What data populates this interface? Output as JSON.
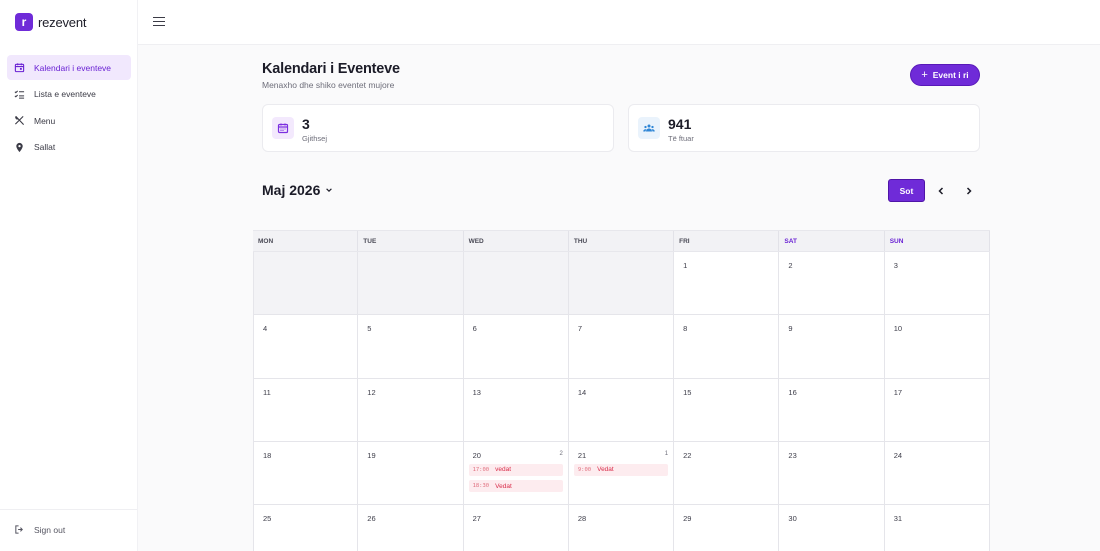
{
  "app": {
    "logo_letter": "r",
    "name": "rezevent",
    "accent": "#6f2bd8"
  },
  "sidebar": {
    "items": [
      {
        "label": "Kalendari i eventeve",
        "icon": "calendar-icon",
        "active": true
      },
      {
        "label": "Lista e eventeve",
        "icon": "checklist-icon",
        "active": false
      },
      {
        "label": "Menu",
        "icon": "utensils-icon",
        "active": false
      },
      {
        "label": "Sallat",
        "icon": "map-pin-icon",
        "active": false
      }
    ],
    "signout": "Sign out"
  },
  "header": {
    "title": "Kalendari i Eventeve",
    "subtitle": "Menaxho dhe shiko eventet mujore",
    "new_event_label": "Event i ri"
  },
  "stats": [
    {
      "value": "3",
      "label": "Gjithsej",
      "icon": "calendar-icon"
    },
    {
      "value": "941",
      "label": "Të ftuar",
      "icon": "users-icon"
    }
  ],
  "calendar": {
    "month_label": "Maj 2026",
    "today_label": "Sot",
    "weekdays": [
      "MON",
      "TUE",
      "WED",
      "THU",
      "FRI",
      "SAT",
      "SUN"
    ],
    "weeks": [
      [
        null,
        null,
        null,
        null,
        {
          "day": "1"
        },
        {
          "day": "2"
        },
        {
          "day": "3"
        }
      ],
      [
        {
          "day": "4"
        },
        {
          "day": "5"
        },
        {
          "day": "6"
        },
        {
          "day": "7"
        },
        {
          "day": "8"
        },
        {
          "day": "9"
        },
        {
          "day": "10"
        }
      ],
      [
        {
          "day": "11"
        },
        {
          "day": "12"
        },
        {
          "day": "13"
        },
        {
          "day": "14"
        },
        {
          "day": "15"
        },
        {
          "day": "16"
        },
        {
          "day": "17"
        }
      ],
      [
        {
          "day": "18"
        },
        {
          "day": "19"
        },
        {
          "day": "20",
          "count": "2",
          "events": [
            {
              "time": "17:00",
              "name": "vedat"
            },
            {
              "time": "18:30",
              "name": "Vedat"
            }
          ]
        },
        {
          "day": "21",
          "count": "1",
          "events": [
            {
              "time": "9:00",
              "name": "Vedat"
            }
          ]
        },
        {
          "day": "22"
        },
        {
          "day": "23"
        },
        {
          "day": "24"
        }
      ],
      [
        {
          "day": "25"
        },
        {
          "day": "26"
        },
        {
          "day": "27"
        },
        {
          "day": "28"
        },
        {
          "day": "29"
        },
        {
          "day": "30"
        },
        {
          "day": "31"
        }
      ]
    ]
  }
}
